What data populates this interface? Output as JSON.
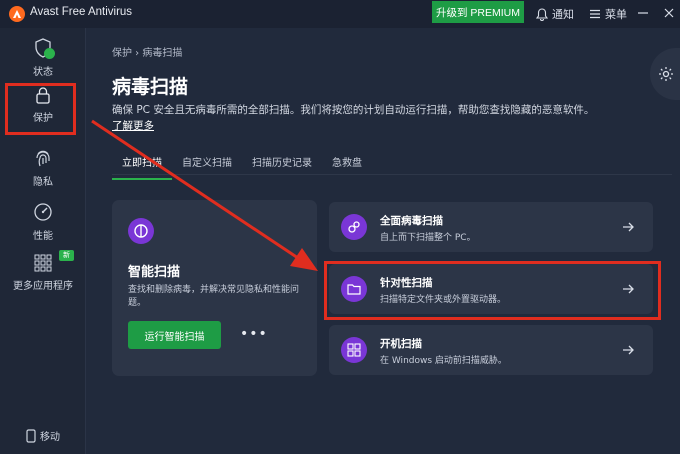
{
  "titlebar": {
    "app_name": "Avast Free Antivirus",
    "upgrade_label": "升级到 PREMIUM",
    "notify_label": "通知",
    "menu_label": "菜单"
  },
  "sidebar": {
    "items": [
      {
        "label": "状态",
        "icon": "shield-check-icon"
      },
      {
        "label": "保护",
        "icon": "lock-icon"
      },
      {
        "label": "隐私",
        "icon": "fingerprint-icon"
      },
      {
        "label": "性能",
        "icon": "speedometer-icon"
      },
      {
        "label": "更多应用程序",
        "icon": "grid-icon",
        "badge": "新"
      }
    ],
    "mobile_label": "移动"
  },
  "main": {
    "breadcrumb": "保护 › 病毒扫描",
    "title": "病毒扫描",
    "description": "确保 PC 安全且无病毒所需的全部扫描。我们将按您的计划自动运行扫描，帮助您查找隐藏的恶意软件。",
    "learn_more": "了解更多",
    "tabs": [
      "立即扫描",
      "自定义扫描",
      "扫描历史记录",
      "急救盘"
    ],
    "smart_scan": {
      "title": "智能扫描",
      "description": "查找和删除病毒，并解决常见隐私和性能问题。",
      "button": "运行智能扫描",
      "more": "•••"
    },
    "scan_options": [
      {
        "title": "全面病毒扫描",
        "subtitle": "自上而下扫描整个 PC。",
        "icon": "microbe-icon"
      },
      {
        "title": "针对性扫描",
        "subtitle": "扫描特定文件夹或外置驱动器。",
        "icon": "folder-icon"
      },
      {
        "title": "开机扫描",
        "subtitle": "在 Windows 启动前扫描威胁。",
        "icon": "windows-grid-icon"
      }
    ]
  },
  "colors": {
    "accent_green": "#1e9c45",
    "icon_purple": "#7a36d6",
    "annotation_red": "#e02d1f",
    "background": "#212a3c"
  }
}
